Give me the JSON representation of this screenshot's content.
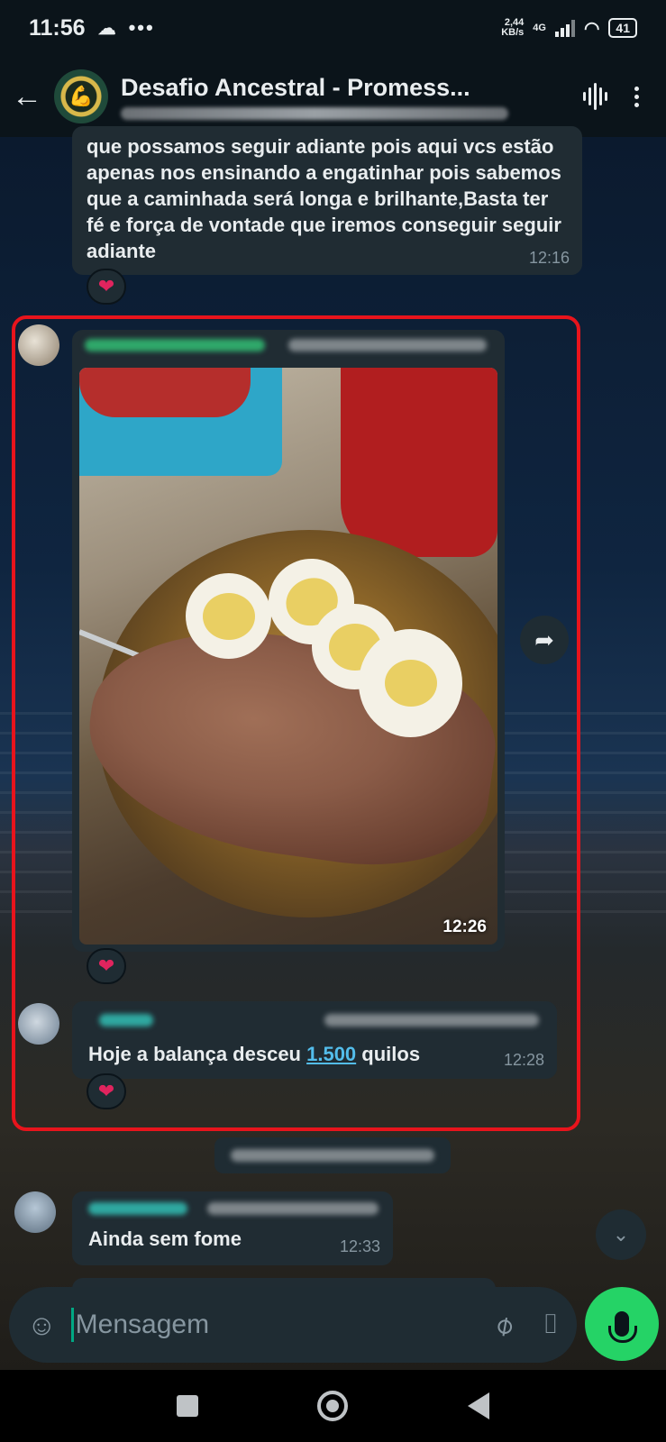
{
  "status_bar": {
    "time": "11:56",
    "net_speed_value": "2,44",
    "net_speed_unit": "KB/s",
    "network": "4G",
    "battery": "41"
  },
  "header": {
    "title": "Desafio Ancestral - Promess...",
    "back_icon": "arrow-left-icon",
    "call_icon": "voice-wave-icon",
    "menu_icon": "kebab-menu-icon"
  },
  "messages": [
    {
      "text": "que possamos seguir adiante pois aqui vcs estão apenas nos ensinando a engatinhar pois sabemos que a caminhada será longa e brilhante,Basta ter fé e força de vontade que iremos conseguir seguir adiante",
      "time": "12:16",
      "reaction": "❤"
    },
    {
      "type": "image",
      "image_description": "steak and boiled eggs on a plate",
      "time": "12:26",
      "reaction": "❤"
    },
    {
      "text_before": "Hoje a balança desceu ",
      "link": "1.500",
      "text_after": " quilos",
      "time": "12:28",
      "reaction": "❤"
    },
    {
      "text": "Ainda sem fome",
      "time": "12:33"
    }
  ],
  "input": {
    "placeholder": "Mensagem",
    "emoji_icon": "sticker-icon",
    "attach_icon": "paperclip-icon",
    "camera_icon": "camera-icon",
    "mic_icon": "microphone-icon"
  },
  "colors": {
    "highlight": "#e8141c",
    "accent": "#25d366",
    "link": "#53bdeb",
    "bubble": "#202c33"
  }
}
